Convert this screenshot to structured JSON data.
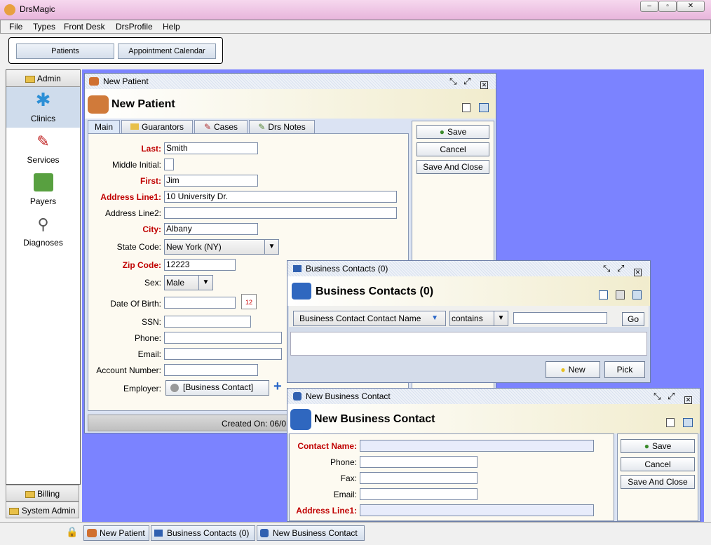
{
  "app": {
    "title": "DrsMagic"
  },
  "menu": [
    "File",
    "Types",
    "Front Desk",
    "DrsProfile",
    "Help"
  ],
  "toolbar": {
    "patients": "Patients",
    "calendar": "Appointment Calendar"
  },
  "left": {
    "admin": "Admin",
    "items": [
      "Clinics",
      "Services",
      "Payers",
      "Diagnoses"
    ],
    "billing": "Billing",
    "system_admin": "System Admin"
  },
  "patient": {
    "window_title": "New Patient",
    "banner": "New Patient",
    "tabs": [
      "Main",
      "Guarantors",
      "Cases",
      "Drs Notes"
    ],
    "labels": {
      "last": "Last:",
      "middle": "Middle Initial:",
      "first": "First:",
      "addr1": "Address Line1:",
      "addr2": "Address Line2:",
      "city": "City:",
      "state": "State Code:",
      "zip": "Zip Code:",
      "sex": "Sex:",
      "dob": "Date Of Birth:",
      "ssn": "SSN:",
      "phone": "Phone:",
      "email": "Email:",
      "account": "Account Number:",
      "employer": "Employer:"
    },
    "values": {
      "last": "Smith",
      "middle": "",
      "first": "Jim",
      "addr1": "10 University Dr.",
      "addr2": "",
      "city": "Albany",
      "state": "New York (NY)",
      "zip": "12223",
      "sex": "Male",
      "dob": "",
      "ssn": "",
      "phone": "",
      "email": "",
      "account": "",
      "employer": "[Business Contact]"
    },
    "buttons": {
      "save": "Save",
      "cancel": "Cancel",
      "save_close": "Save And Close"
    },
    "created_on": "Created On: 06/0"
  },
  "contacts": {
    "window_title": "Business Contacts (0)",
    "banner": "Business Contacts (0)",
    "filter_field": "Business Contact Contact Name",
    "filter_op": "contains",
    "filter_value": "",
    "go": "Go",
    "new": "New",
    "pick": "Pick"
  },
  "newcontact": {
    "window_title": "New Business Contact",
    "banner": "New Business Contact",
    "labels": {
      "name": "Contact Name:",
      "phone": "Phone:",
      "fax": "Fax:",
      "email": "Email:",
      "addr1": "Address Line1:"
    },
    "buttons": {
      "save": "Save",
      "cancel": "Cancel",
      "save_close": "Save And Close"
    }
  },
  "taskbar": [
    "New Patient",
    "Business Contacts (0)",
    "New Business Contact"
  ]
}
